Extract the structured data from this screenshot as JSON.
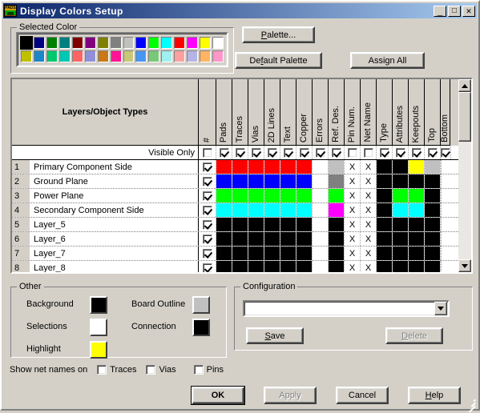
{
  "window": {
    "title": "Display Colors Setup",
    "icon": "pads-app-icon",
    "minimize_label": "_",
    "maximize_label": "□",
    "close_label": "✕"
  },
  "selected_color": {
    "legend": "Selected Color",
    "selected_index": 0,
    "row1": [
      "#000000",
      "#000080",
      "#008000",
      "#008080",
      "#800000",
      "#800080",
      "#808000",
      "#808080",
      "#c0c0c0",
      "#0000ff",
      "#00ff00",
      "#00ffff",
      "#ff0000",
      "#ff00ff",
      "#ffff00",
      "#ffffff"
    ],
    "row2": [
      "#c0c000",
      "#1c86c8",
      "#00c86e",
      "#00c8b4",
      "#ff6464",
      "#9090d8",
      "#c87818",
      "#ff1493",
      "#c8c878",
      "#4896f0",
      "#78c878",
      "#a0f0f0",
      "#ffa0a0",
      "#b4b4e6",
      "#ffb464",
      "#ff96c8"
    ]
  },
  "buttons": {
    "palette": "Palette...",
    "palette_accel": "P",
    "default_palette": "Default Palette",
    "default_palette_accel": "f",
    "assign_all": "Assign All"
  },
  "table": {
    "layers_header": "Layers/Object Types",
    "columns": [
      "#",
      "Pads",
      "Traces",
      "Vias",
      "2D Lines",
      "Text",
      "Copper",
      "Errors",
      "Ref. Des.",
      "Pin Num.",
      "Net Name",
      "Type",
      "Attributes",
      "Keepouts",
      "Top",
      "Bottom"
    ],
    "visible_only_label": "Visible Only",
    "visible_only_checks": [
      false,
      true,
      true,
      true,
      true,
      true,
      true,
      true,
      true,
      false,
      false,
      true,
      true,
      true,
      true,
      true
    ],
    "rows": [
      {
        "num": "1",
        "name": "Primary Component Side",
        "check": true,
        "cells": [
          "#ff0000",
          "#ff0000",
          "#ff0000",
          "#ff0000",
          "#ff0000",
          "#ff0000",
          "#ffffff",
          "#c0c0c0",
          "X",
          "X",
          "#000000",
          "#000000",
          "#ffff00",
          "#c0c0c0",
          "#000000"
        ]
      },
      {
        "num": "2",
        "name": "Ground Plane",
        "check": true,
        "cells": [
          "#0000ff",
          "#0000ff",
          "#0000ff",
          "#0000ff",
          "#0000ff",
          "#0000ff",
          "#ffffff",
          "#808080",
          "X",
          "X",
          "#000000",
          "#000000",
          "#000000",
          "#000000",
          "#000000"
        ]
      },
      {
        "num": "3",
        "name": "Power Plane",
        "check": true,
        "cells": [
          "#00ff00",
          "#00ff00",
          "#00ff00",
          "#00ff00",
          "#00ff00",
          "#00ff00",
          "#ffffff",
          "#00ff00",
          "X",
          "X",
          "#000000",
          "#00ff00",
          "#00ff00",
          "#000000",
          "#000000"
        ]
      },
      {
        "num": "4",
        "name": "Secondary Component Side",
        "check": true,
        "cells": [
          "#00ffff",
          "#00ffff",
          "#00ffff",
          "#00ffff",
          "#00ffff",
          "#00ffff",
          "#ffffff",
          "#ff00ff",
          "X",
          "X",
          "#000000",
          "#00ffff",
          "#00ffff",
          "#000000",
          "#ff00ff"
        ]
      },
      {
        "num": "5",
        "name": "Layer_5",
        "check": true,
        "cells": [
          "#000000",
          "#000000",
          "#000000",
          "#000000",
          "#000000",
          "#000000",
          "#ffffff",
          "#000000",
          "X",
          "X",
          "#000000",
          "#000000",
          "#000000",
          "#000000",
          "#000000"
        ]
      },
      {
        "num": "6",
        "name": "Layer_6",
        "check": true,
        "cells": [
          "#000000",
          "#000000",
          "#000000",
          "#000000",
          "#000000",
          "#000000",
          "#ffffff",
          "#000000",
          "X",
          "X",
          "#000000",
          "#000000",
          "#000000",
          "#000000",
          "#000000"
        ]
      },
      {
        "num": "7",
        "name": "Layer_7",
        "check": true,
        "cells": [
          "#000000",
          "#000000",
          "#000000",
          "#000000",
          "#000000",
          "#000000",
          "#ffffff",
          "#000000",
          "X",
          "X",
          "#000000",
          "#000000",
          "#000000",
          "#000000",
          "#000000"
        ]
      },
      {
        "num": "8",
        "name": "Layer_8",
        "check": true,
        "cells": [
          "#000000",
          "#000000",
          "#000000",
          "#000000",
          "#000000",
          "#000000",
          "#ffffff",
          "#000000",
          "X",
          "X",
          "#000000",
          "#000000",
          "#000000",
          "#000000",
          "#000000"
        ]
      }
    ]
  },
  "other": {
    "legend": "Other",
    "items": [
      {
        "label": "Background",
        "color": "#000000"
      },
      {
        "label": "Selections",
        "color": "#ffffff"
      },
      {
        "label": "Highlight",
        "color": "#ffff00"
      },
      {
        "label": "Board Outline",
        "color": "#c0c0c0"
      },
      {
        "label": "Connection",
        "color": "#000000"
      }
    ]
  },
  "configuration": {
    "legend": "Configuration",
    "value": "",
    "dropdown_icon": "chevron-down-icon",
    "save": "Save",
    "save_accel": "S",
    "delete": "Delete",
    "delete_accel": "D",
    "delete_disabled": true
  },
  "netnames": {
    "label": "Show net names on",
    "options": [
      {
        "label": "Traces",
        "checked": false
      },
      {
        "label": "Vias",
        "checked": false
      },
      {
        "label": "Pins",
        "checked": false
      }
    ]
  },
  "footer": {
    "ok": "OK",
    "apply": "Apply",
    "apply_disabled": true,
    "cancel": "Cancel",
    "help": "Help",
    "help_accel": "H"
  }
}
